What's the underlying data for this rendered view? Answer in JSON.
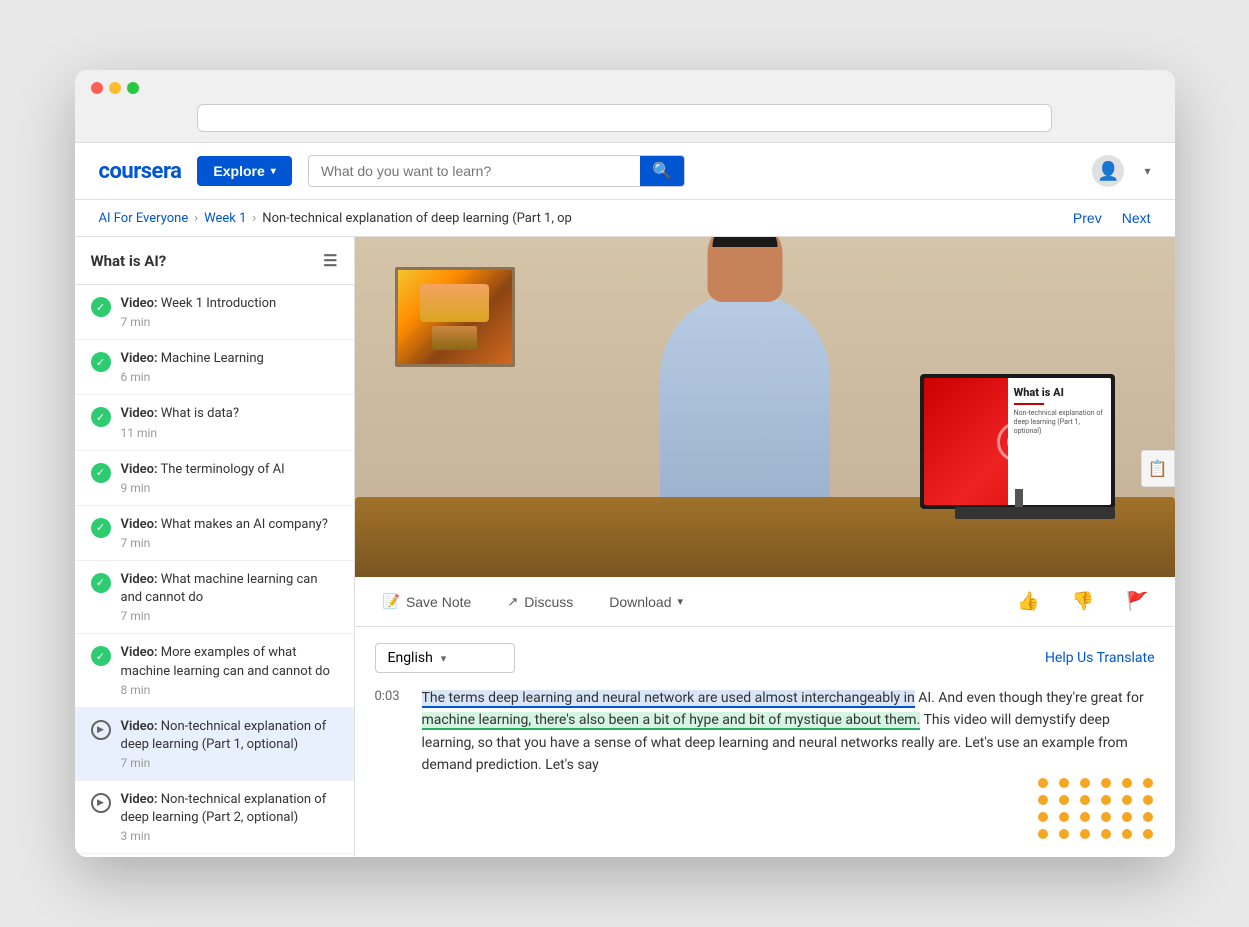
{
  "browser": {
    "dots": [
      "red",
      "yellow",
      "green"
    ]
  },
  "header": {
    "logo": "coursera",
    "explore_label": "Explore",
    "search_placeholder": "What do you want to learn?",
    "search_icon": "🔍"
  },
  "breadcrumb": {
    "course": "AI For Everyone",
    "week": "Week 1",
    "current": "Non-technical explanation of deep learning (Part 1, op",
    "prev": "Prev",
    "next": "Next"
  },
  "sidebar": {
    "title": "What is AI?",
    "items": [
      {
        "type": "checked",
        "bold": "Video:",
        "label": "Week 1 Introduction",
        "duration": "7 min"
      },
      {
        "type": "checked",
        "bold": "Video:",
        "label": "Machine Learning",
        "duration": "6 min"
      },
      {
        "type": "checked",
        "bold": "Video:",
        "label": "What is data?",
        "duration": "11 min"
      },
      {
        "type": "checked",
        "bold": "Video:",
        "label": "The terminology of AI",
        "duration": "9 min"
      },
      {
        "type": "checked",
        "bold": "Video:",
        "label": "What makes an AI company?",
        "duration": "7 min"
      },
      {
        "type": "checked",
        "bold": "Video:",
        "label": "What machine learning can and cannot do",
        "duration": "7 min"
      },
      {
        "type": "checked",
        "bold": "Video:",
        "label": "More examples of what machine learning can and cannot do",
        "duration": "8 min"
      },
      {
        "type": "play",
        "bold": "Video:",
        "label": "Non-technical explanation of deep learning (Part 1, optional)",
        "duration": "7 min",
        "active": true
      },
      {
        "type": "play",
        "bold": "Video:",
        "label": "Non-technical explanation of deep learning (Part 2, optional)",
        "duration": "3 min"
      }
    ]
  },
  "toolbar": {
    "save_note_icon": "📝",
    "save_note_label": "Save Note",
    "discuss_icon": "↗",
    "discuss_label": "Discuss",
    "download_label": "Download",
    "download_icon": "▼",
    "thumbs_up": "👍",
    "thumbs_down": "👎",
    "flag": "🚩"
  },
  "transcript": {
    "language": "English",
    "help_translate": "Help Us Translate",
    "timestamp": "0:03",
    "text_part1": "The terms deep learning and neural network are used almost interchangeably in",
    "text_part2": " AI. And even though they're great for ",
    "text_highlighted2": "machine learning, there's also been a bit of hype and bit of mystique about them.",
    "text_part3": " This video will demystify deep learning, so that you have a sense of what deep learning and neural networks really are. Let's use an example from demand prediction. Let's say"
  },
  "monitor_display": {
    "title": "What is AI",
    "subtitle": "Non-technical explanation of\ndeep learning (Part 1, optional)"
  },
  "colors": {
    "coursera_blue": "#0056d2",
    "highlight_blue": "rgba(0,86,210,0.15)",
    "highlight_green": "rgba(46,204,113,0.2)",
    "orange_dot": "#f5a623",
    "green_check": "#2ecc71"
  }
}
